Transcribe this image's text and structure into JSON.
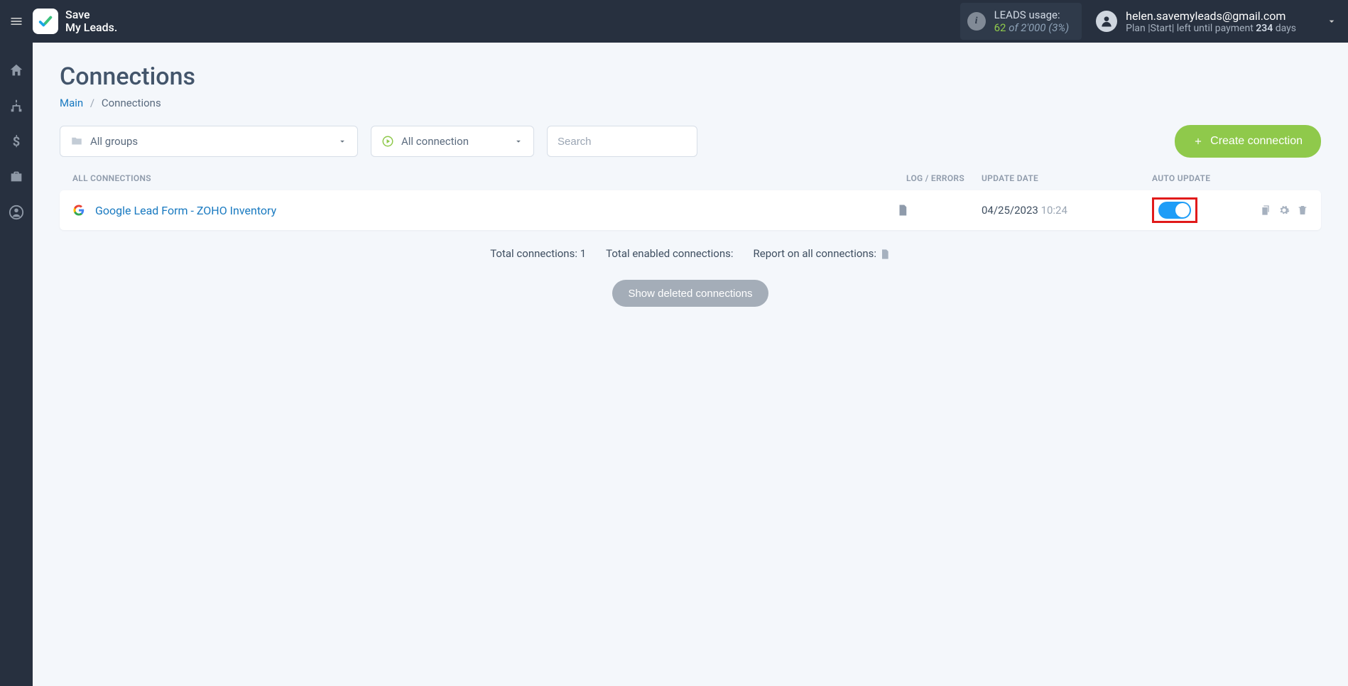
{
  "header": {
    "logo_line1": "Save",
    "logo_line2": "My Leads.",
    "leads_label": "LEADS usage:",
    "leads_used": "62",
    "leads_of": "of",
    "leads_total": "2'000",
    "leads_pct": "(3%)",
    "account_email": "helen.savemyleads@gmail.com",
    "plan_prefix": "Plan |",
    "plan_name": "Start",
    "plan_mid": "|  left until payment ",
    "plan_days": "234",
    "plan_suffix": " days"
  },
  "page": {
    "title": "Connections",
    "breadcrumb_main": "Main",
    "breadcrumb_current": "Connections"
  },
  "filters": {
    "groups_label": "All groups",
    "status_label": "All connection",
    "search_placeholder": "Search",
    "create_button": "Create connection"
  },
  "table": {
    "header_all": "ALL CONNECTIONS",
    "header_log": "LOG / ERRORS",
    "header_date": "UPDATE DATE",
    "header_auto": "AUTO UPDATE",
    "rows": [
      {
        "name": "Google Lead Form - ZOHO Inventory",
        "date": "04/25/2023",
        "time": "10:24",
        "auto_update": true
      }
    ]
  },
  "summary": {
    "total_conn_label": "Total connections:",
    "total_conn_value": "1",
    "total_enabled_label": "Total enabled connections:",
    "report_label": "Report on all connections:"
  },
  "buttons": {
    "show_deleted": "Show deleted connections"
  }
}
